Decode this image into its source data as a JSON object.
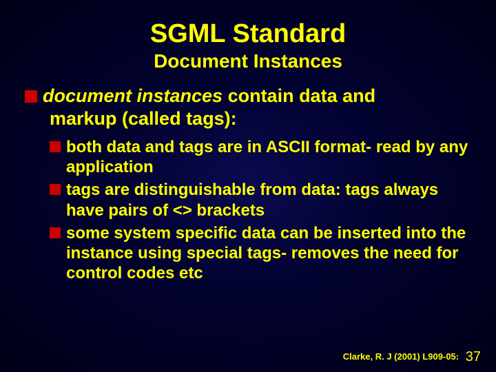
{
  "title": "SGML Standard",
  "subtitle": "Document Instances",
  "main": {
    "lead_emph": "document instances",
    "lead_rest": " contain data and",
    "cont": "markup (called tags):",
    "subs": [
      "both data and tags are in ASCII format- read by any application",
      "tags are distinguishable from data: tags always have pairs of <> brackets",
      "some system specific data can be inserted into the instance using special tags- removes the need for control codes etc"
    ]
  },
  "footer": {
    "citation": "Clarke, R. J (2001) L909-05:",
    "page": "37"
  }
}
